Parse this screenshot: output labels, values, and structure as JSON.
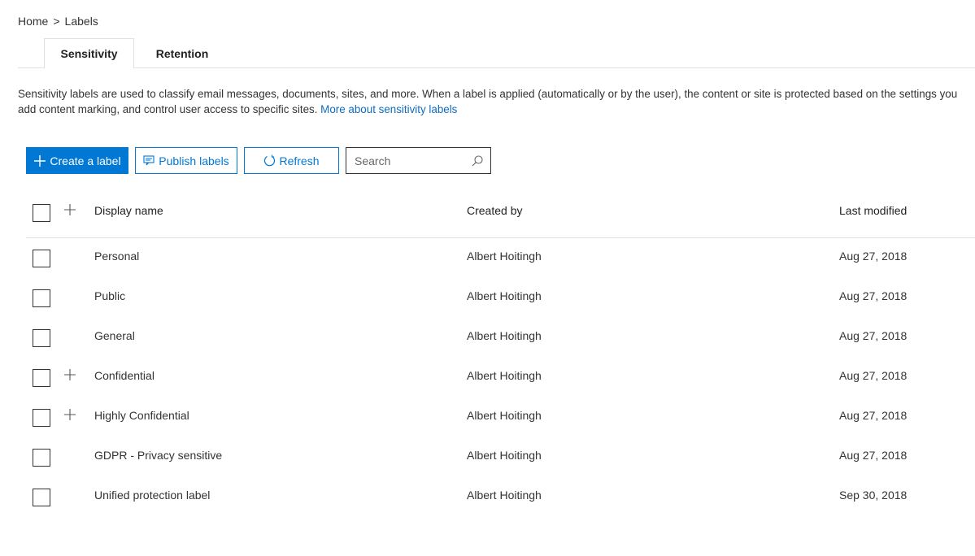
{
  "breadcrumb": {
    "home": "Home",
    "separator": ">",
    "current": "Labels"
  },
  "tabs": [
    {
      "label": "Sensitivity",
      "active": true
    },
    {
      "label": "Retention",
      "active": false
    }
  ],
  "description": {
    "text": "Sensitivity labels are used to classify email messages, documents, sites, and more. When a label is applied (automatically or by the user), the content or site is protected based on the settings you",
    "text2": "add content marking, and control user access to specific sites.",
    "link": "More about sensitivity labels"
  },
  "toolbar": {
    "create_label": "Create a label",
    "publish_label": "Publish labels",
    "refresh_label": "Refresh",
    "search_placeholder": "Search"
  },
  "table": {
    "columns": [
      "Display name",
      "Created by",
      "Last modified"
    ],
    "rows": [
      {
        "name": "Personal",
        "created_by": "Albert Hoitingh",
        "modified": "Aug 27, 2018",
        "expandable": false
      },
      {
        "name": "Public",
        "created_by": "Albert Hoitingh",
        "modified": "Aug 27, 2018",
        "expandable": false
      },
      {
        "name": "General",
        "created_by": "Albert Hoitingh",
        "modified": "Aug 27, 2018",
        "expandable": false
      },
      {
        "name": "Confidential",
        "created_by": "Albert Hoitingh",
        "modified": "Aug 27, 2018",
        "expandable": true
      },
      {
        "name": "Highly Confidential",
        "created_by": "Albert Hoitingh",
        "modified": "Aug 27, 2018",
        "expandable": true
      },
      {
        "name": "GDPR - Privacy sensitive",
        "created_by": "Albert Hoitingh",
        "modified": "Aug 27, 2018",
        "expandable": false
      },
      {
        "name": "Unified protection label",
        "created_by": "Albert Hoitingh",
        "modified": "Sep 30, 2018",
        "expandable": false
      }
    ]
  },
  "colors": {
    "accent": "#0078d4",
    "link": "#0f6cbd",
    "border": "#e1e1e1"
  }
}
